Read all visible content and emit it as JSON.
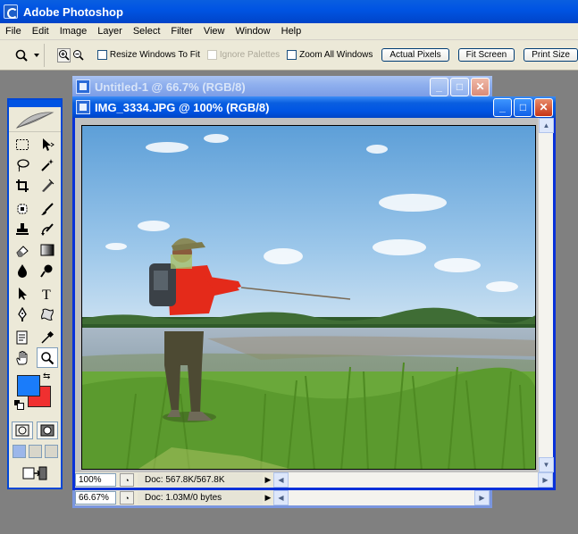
{
  "app": {
    "title": "Adobe Photoshop"
  },
  "menu": [
    "File",
    "Edit",
    "Image",
    "Layer",
    "Select",
    "Filter",
    "View",
    "Window",
    "Help"
  ],
  "options": {
    "resize_windows": "Resize Windows To Fit",
    "ignore_palettes": "Ignore Palettes",
    "zoom_all": "Zoom All Windows",
    "actual_pixels": "Actual Pixels",
    "fit_screen": "Fit Screen",
    "print_size": "Print Size"
  },
  "colors": {
    "foreground": "#1a7cfa",
    "background": "#f03030"
  },
  "windows": {
    "back": {
      "title": "Untitled-1 @ 66.7% (RGB/8)",
      "zoom": "66.67%",
      "doc": "Doc: 1.03M/0 bytes"
    },
    "front": {
      "title": "IMG_3334.JPG @ 100% (RGB/8)",
      "zoom": "100%",
      "doc": "Doc: 567.8K/567.8K"
    }
  },
  "icons": [
    "photoshop-icon",
    "zoom-tool-icon",
    "feather-icon",
    "marquee-icon",
    "move-icon",
    "lasso-icon",
    "magic-wand-icon",
    "crop-icon",
    "slice-icon",
    "healing-icon",
    "brush-icon",
    "stamp-icon",
    "history-brush-icon",
    "eraser-icon",
    "gradient-icon",
    "blur-icon",
    "dodge-icon",
    "path-select-icon",
    "type-icon",
    "pen-icon",
    "shape-icon",
    "notes-icon",
    "eyedropper-icon",
    "hand-icon",
    "zoom-icon",
    "swap-colors-icon",
    "default-colors-icon",
    "quick-mask-icon",
    "screen-mode-icon",
    "jump-to-imageready-icon"
  ]
}
